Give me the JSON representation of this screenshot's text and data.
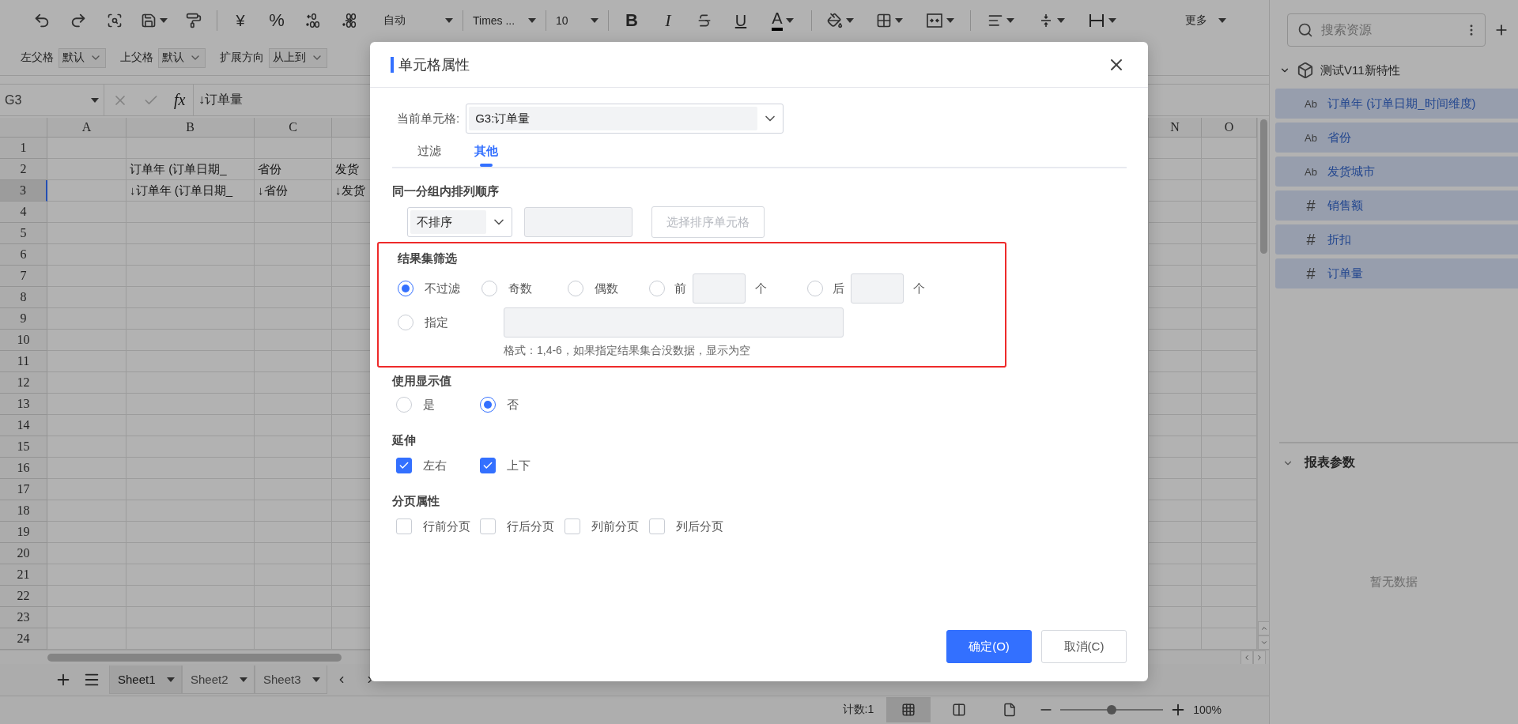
{
  "toolbar": {
    "currency": "¥",
    "percent": "%",
    "number_format": "自动",
    "font": "Times ...",
    "font_size": "10",
    "bold": "B",
    "italic": "I",
    "underline": "U",
    "font_color": "A",
    "more": "更多"
  },
  "toolbar2": [
    {
      "label": "左父格",
      "value": "默认"
    },
    {
      "label": "上父格",
      "value": "默认"
    },
    {
      "label": "扩展方向",
      "value": "从上到"
    }
  ],
  "formula_bar": {
    "cell": "G3",
    "fx": "fx",
    "formula": "↓订单量"
  },
  "sheet": {
    "columns": [
      "A",
      "B",
      "C",
      "N",
      "O"
    ],
    "rows": [
      {
        "label": "1",
        "selected": false
      },
      {
        "label": "2",
        "selected": false,
        "b": "订单年 (订单日期_",
        "c": "省份",
        "d": "发货"
      },
      {
        "label": "3",
        "selected": true,
        "b": "↓订单年 (订单日期_",
        "c": "↓省份",
        "d": "↓发货"
      },
      {
        "label": "4",
        "selected": false
      },
      {
        "label": "5",
        "selected": false
      },
      {
        "label": "6",
        "selected": false
      },
      {
        "label": "7",
        "selected": false
      },
      {
        "label": "8",
        "selected": false
      },
      {
        "label": "9",
        "selected": false
      },
      {
        "label": "10",
        "selected": false
      },
      {
        "label": "11",
        "selected": false
      },
      {
        "label": "12",
        "selected": false
      },
      {
        "label": "13",
        "selected": false
      },
      {
        "label": "14",
        "selected": false
      },
      {
        "label": "15",
        "selected": false
      },
      {
        "label": "16",
        "selected": false
      },
      {
        "label": "17",
        "selected": false
      },
      {
        "label": "18",
        "selected": false
      },
      {
        "label": "19",
        "selected": false
      },
      {
        "label": "20",
        "selected": false
      },
      {
        "label": "21",
        "selected": false
      },
      {
        "label": "22",
        "selected": false
      },
      {
        "label": "23",
        "selected": false
      },
      {
        "label": "24",
        "selected": false
      }
    ]
  },
  "sheet_tabs": [
    {
      "label": "Sheet1",
      "selected": true
    },
    {
      "label": "Sheet2",
      "selected": false
    },
    {
      "label": "Sheet3",
      "selected": false
    }
  ],
  "status_bar": {
    "count": "计数:1",
    "views": [
      {
        "selected": true
      },
      {
        "selected": false
      },
      {
        "selected": false
      }
    ],
    "zoom": {
      "level": 0.5,
      "reading": "100%"
    }
  },
  "side_panel": {
    "search": {
      "placeholder": "搜索资源"
    },
    "dataset": {
      "label": "测试V11新特性",
      "expanded": true,
      "fields": [
        {
          "glyph": "Ab",
          "label": "订单年 (订单日期_时间维度)"
        },
        {
          "glyph": "Ab",
          "label": "省份"
        },
        {
          "glyph": "Ab",
          "label": "发货城市"
        },
        {
          "glyph": "#",
          "label": "销售额"
        },
        {
          "glyph": "#",
          "label": "折扣"
        },
        {
          "glyph": "#",
          "label": "订单量"
        }
      ]
    },
    "params": {
      "label": "报表参数",
      "expanded": true,
      "empty": "暂无数据"
    }
  },
  "dialog": {
    "title": "单元格属性",
    "current_cell_label": "当前单元格:",
    "current_cell": "G3:订单量",
    "tabs": [
      {
        "label": "过滤",
        "selected": false
      },
      {
        "label": "其他",
        "selected": true
      }
    ],
    "sort": {
      "title": "同一分组内排列顺序",
      "order": "不排序",
      "pick_button": {
        "label": "选择排序单元格",
        "disabled": true
      }
    },
    "result_filter": {
      "title": "结果集筛选",
      "highlighted": true,
      "options": [
        {
          "kind": "plain",
          "label": "不过滤",
          "selected": true
        },
        {
          "kind": "plain",
          "label": "奇数",
          "selected": false
        },
        {
          "kind": "plain",
          "label": "偶数",
          "selected": false
        },
        {
          "kind": "count",
          "label": "前",
          "unit": "个",
          "selected": false
        },
        {
          "kind": "count",
          "label": "后",
          "unit": "个",
          "selected": false
        }
      ],
      "specify": {
        "label": "指定",
        "selected": false,
        "hint": "格式：1,4-6，如果指定结果集合没数据，显示为空"
      }
    },
    "display_value": {
      "title": "使用显示值",
      "options": [
        {
          "label": "是",
          "selected": false
        },
        {
          "label": "否",
          "selected": true
        }
      ]
    },
    "extend": {
      "title": "延伸",
      "options": [
        {
          "label": "左右",
          "checked": true
        },
        {
          "label": "上下",
          "checked": true
        }
      ]
    },
    "page_break": {
      "title": "分页属性",
      "options": [
        {
          "label": "行前分页",
          "checked": false
        },
        {
          "label": "行后分页",
          "checked": false
        },
        {
          "label": "列前分页",
          "checked": false
        },
        {
          "label": "列后分页",
          "checked": false
        }
      ]
    },
    "buttons": [
      {
        "kind": "primary",
        "label": "确定(O)"
      },
      {
        "kind": "secondary",
        "label": "取消(C)"
      }
    ]
  }
}
